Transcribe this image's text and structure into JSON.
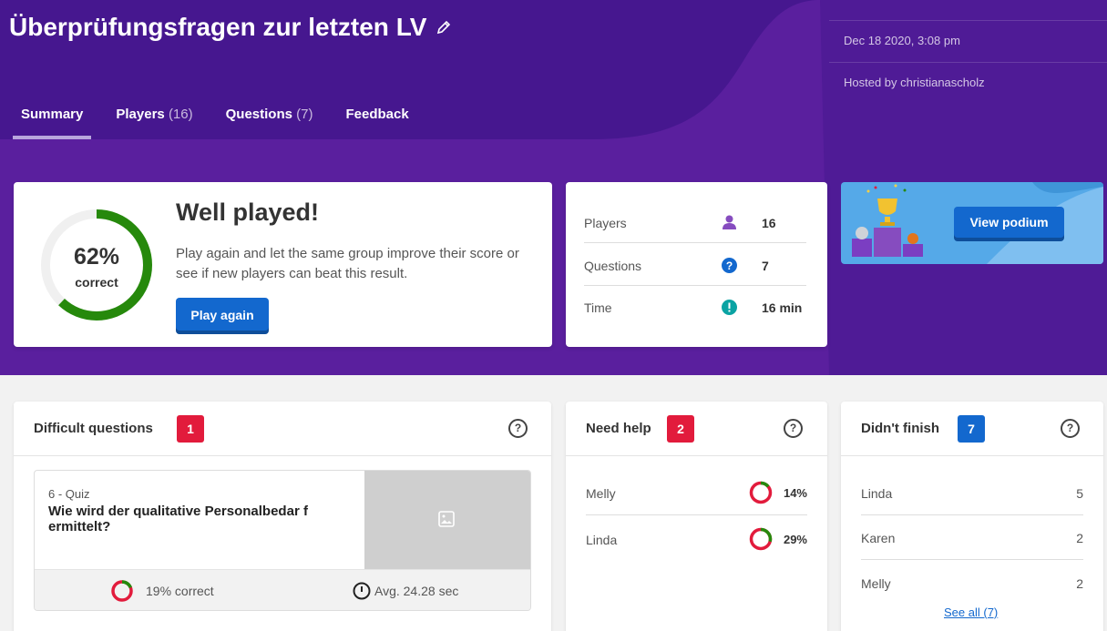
{
  "header": {
    "title": "Überprüfungsfragen zur letzten LV",
    "date": "Dec 18 2020, 3:08 pm",
    "hosted_by": "Hosted by christianascholz"
  },
  "tabs": [
    {
      "label": "Summary",
      "count": ""
    },
    {
      "label": "Players",
      "count": "(16)"
    },
    {
      "label": "Questions",
      "count": "(7)"
    },
    {
      "label": "Feedback",
      "count": ""
    }
  ],
  "summary": {
    "percent": "62%",
    "percent_value": 62,
    "correct_label": "correct",
    "heading": "Well played!",
    "description": "Play again and let the same group improve their score or see if new players can beat this result.",
    "play_again": "Play again"
  },
  "stats": [
    {
      "label": "Players",
      "icon": "player-icon",
      "value": "16"
    },
    {
      "label": "Questions",
      "icon": "question-icon",
      "value": "7"
    },
    {
      "label": "Time",
      "icon": "time-icon",
      "value": "16 min"
    }
  ],
  "podium": {
    "button": "View podium"
  },
  "difficult": {
    "title": "Difficult questions",
    "badge": "1",
    "question": {
      "meta": "6 - Quiz",
      "text": "Wie wird der qualitative Personalbedar f ermittelt?",
      "correct": "19% correct",
      "correct_value": 19,
      "avg": "Avg. 24.28 sec"
    }
  },
  "need_help": {
    "title": "Need help",
    "badge": "2",
    "rows": [
      {
        "name": "Melly",
        "percent": "14%",
        "value": 14
      },
      {
        "name": "Linda",
        "percent": "29%",
        "value": 29
      }
    ]
  },
  "didnt_finish": {
    "title": "Didn't finish",
    "badge": "7",
    "rows": [
      {
        "name": "Linda",
        "count": "5"
      },
      {
        "name": "Karen",
        "count": "2"
      },
      {
        "name": "Melly",
        "count": "2"
      }
    ],
    "see_all": "See all (7)"
  },
  "colors": {
    "brand_purple": "#46178f",
    "correct_green": "#26890c",
    "wrong_red": "#e21b3c",
    "button_blue": "#1368ce"
  }
}
